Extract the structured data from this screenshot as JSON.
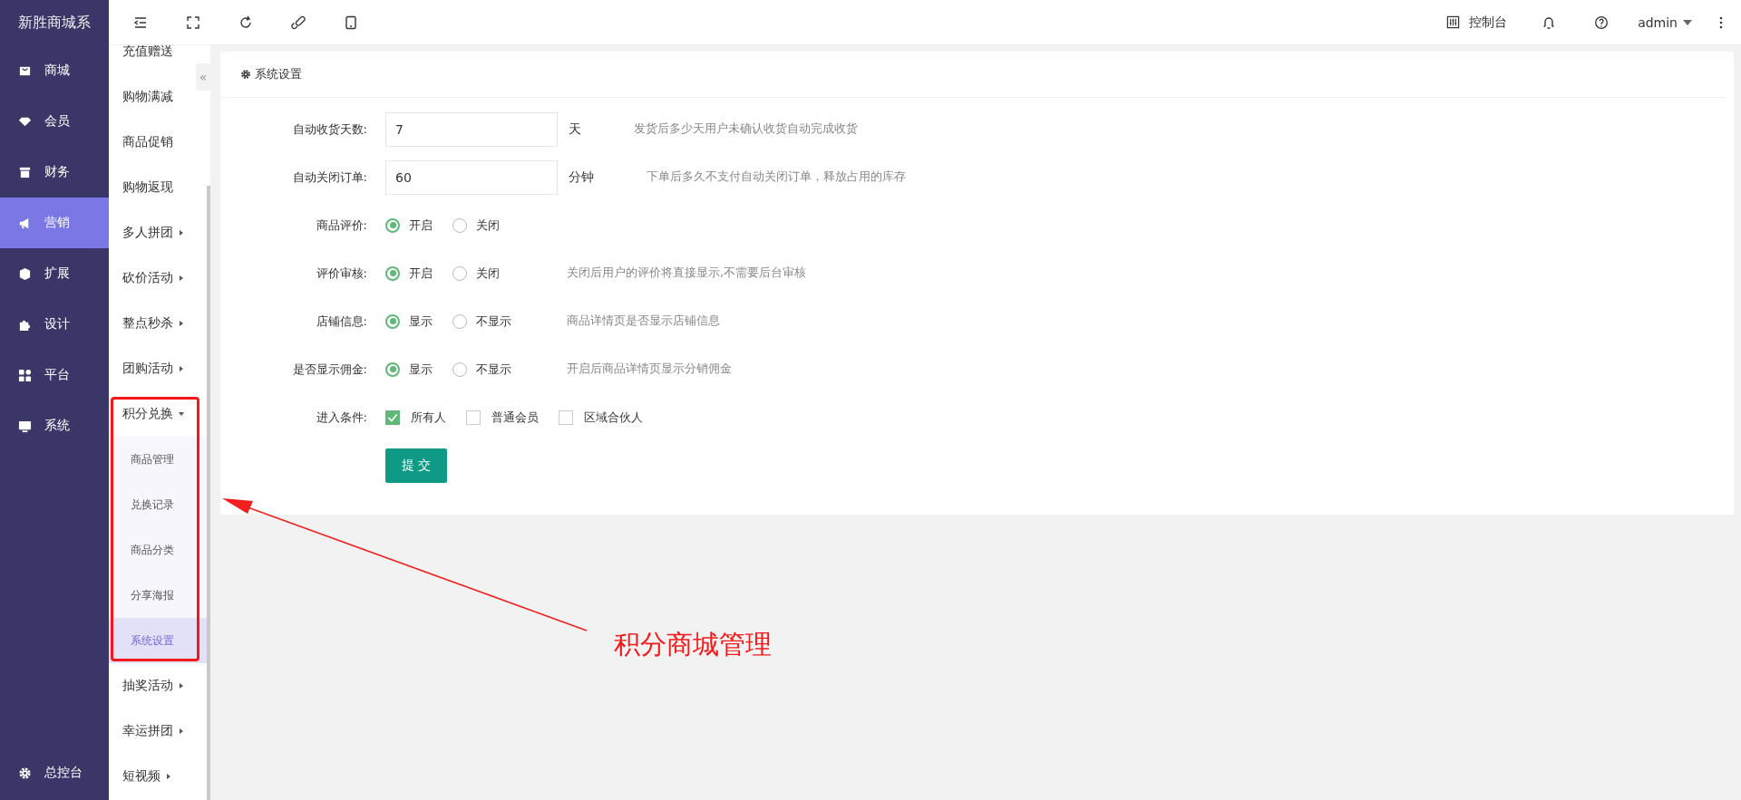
{
  "brand": "新胜商城系",
  "main_menu": [
    {
      "label": "商城",
      "selected": false
    },
    {
      "label": "会员",
      "selected": false
    },
    {
      "label": "财务",
      "selected": false
    },
    {
      "label": "营销",
      "selected": true
    },
    {
      "label": "扩展",
      "selected": false
    },
    {
      "label": "设计",
      "selected": false
    },
    {
      "label": "平台",
      "selected": false
    },
    {
      "label": "系统",
      "selected": false
    }
  ],
  "main_menu_footer": "总控台",
  "collapse_toggle": "«",
  "submenu": [
    {
      "label": "充值赠送",
      "kind": "link",
      "selected": false
    },
    {
      "label": "购物满减",
      "kind": "link",
      "selected": false
    },
    {
      "label": "商品促销",
      "kind": "link",
      "selected": false
    },
    {
      "label": "购物返现",
      "kind": "link",
      "selected": false
    },
    {
      "label": "多人拼团",
      "kind": "group",
      "expanded": false
    },
    {
      "label": "砍价活动",
      "kind": "group",
      "expanded": false
    },
    {
      "label": "整点秒杀",
      "kind": "group",
      "expanded": false
    },
    {
      "label": "团购活动",
      "kind": "group",
      "expanded": false
    },
    {
      "label": "积分兑换",
      "kind": "group",
      "expanded": true,
      "children": [
        {
          "label": "商品管理",
          "selected": false
        },
        {
          "label": "兑换记录",
          "selected": false
        },
        {
          "label": "商品分类",
          "selected": false
        },
        {
          "label": "分享海报",
          "selected": false
        },
        {
          "label": "系统设置",
          "selected": true
        }
      ]
    },
    {
      "label": "抽奖活动",
      "kind": "group",
      "expanded": false
    },
    {
      "label": "幸运拼团",
      "kind": "group",
      "expanded": false
    },
    {
      "label": "短视频",
      "kind": "group",
      "expanded": false
    }
  ],
  "topbar": {
    "console": "控制台",
    "user": "admin"
  },
  "card": {
    "title": "系统设置",
    "fields": [
      {
        "kind": "text",
        "label": "自动收货天数:",
        "value": "7",
        "unit": "天",
        "hint": "发货后多少天用户未确认收货自动完成收货"
      },
      {
        "kind": "text",
        "label": "自动关闭订单:",
        "value": "60",
        "unit": "分钟",
        "hint": "下单后多久不支付自动关闭订单，释放占用的库存"
      },
      {
        "kind": "radio",
        "label": "商品评价:",
        "options": [
          {
            "label": "开启",
            "selected": true
          },
          {
            "label": "关闭",
            "selected": false
          }
        ]
      },
      {
        "kind": "radio",
        "label": "评价审核:",
        "options": [
          {
            "label": "开启",
            "selected": true
          },
          {
            "label": "关闭",
            "selected": false
          }
        ],
        "hint": "关闭后用户的评价将直接显示,不需要后台审核"
      },
      {
        "kind": "radio",
        "label": "店铺信息:",
        "options": [
          {
            "label": "显示",
            "selected": true
          },
          {
            "label": "不显示",
            "selected": false
          }
        ],
        "hint": "商品详情页是否显示店铺信息"
      },
      {
        "kind": "radio",
        "label": "是否显示佣金:",
        "options": [
          {
            "label": "显示",
            "selected": true
          },
          {
            "label": "不显示",
            "selected": false
          }
        ],
        "hint": "开启后商品详情页显示分销佣金"
      },
      {
        "kind": "checkbox",
        "label": "进入条件:",
        "options": [
          {
            "label": "所有人",
            "checked": true
          },
          {
            "label": "普通会员",
            "checked": false
          },
          {
            "label": "区域合伙人",
            "checked": false
          }
        ]
      }
    ],
    "submit": "提 交"
  },
  "annotation": {
    "text": "积分商城管理"
  }
}
